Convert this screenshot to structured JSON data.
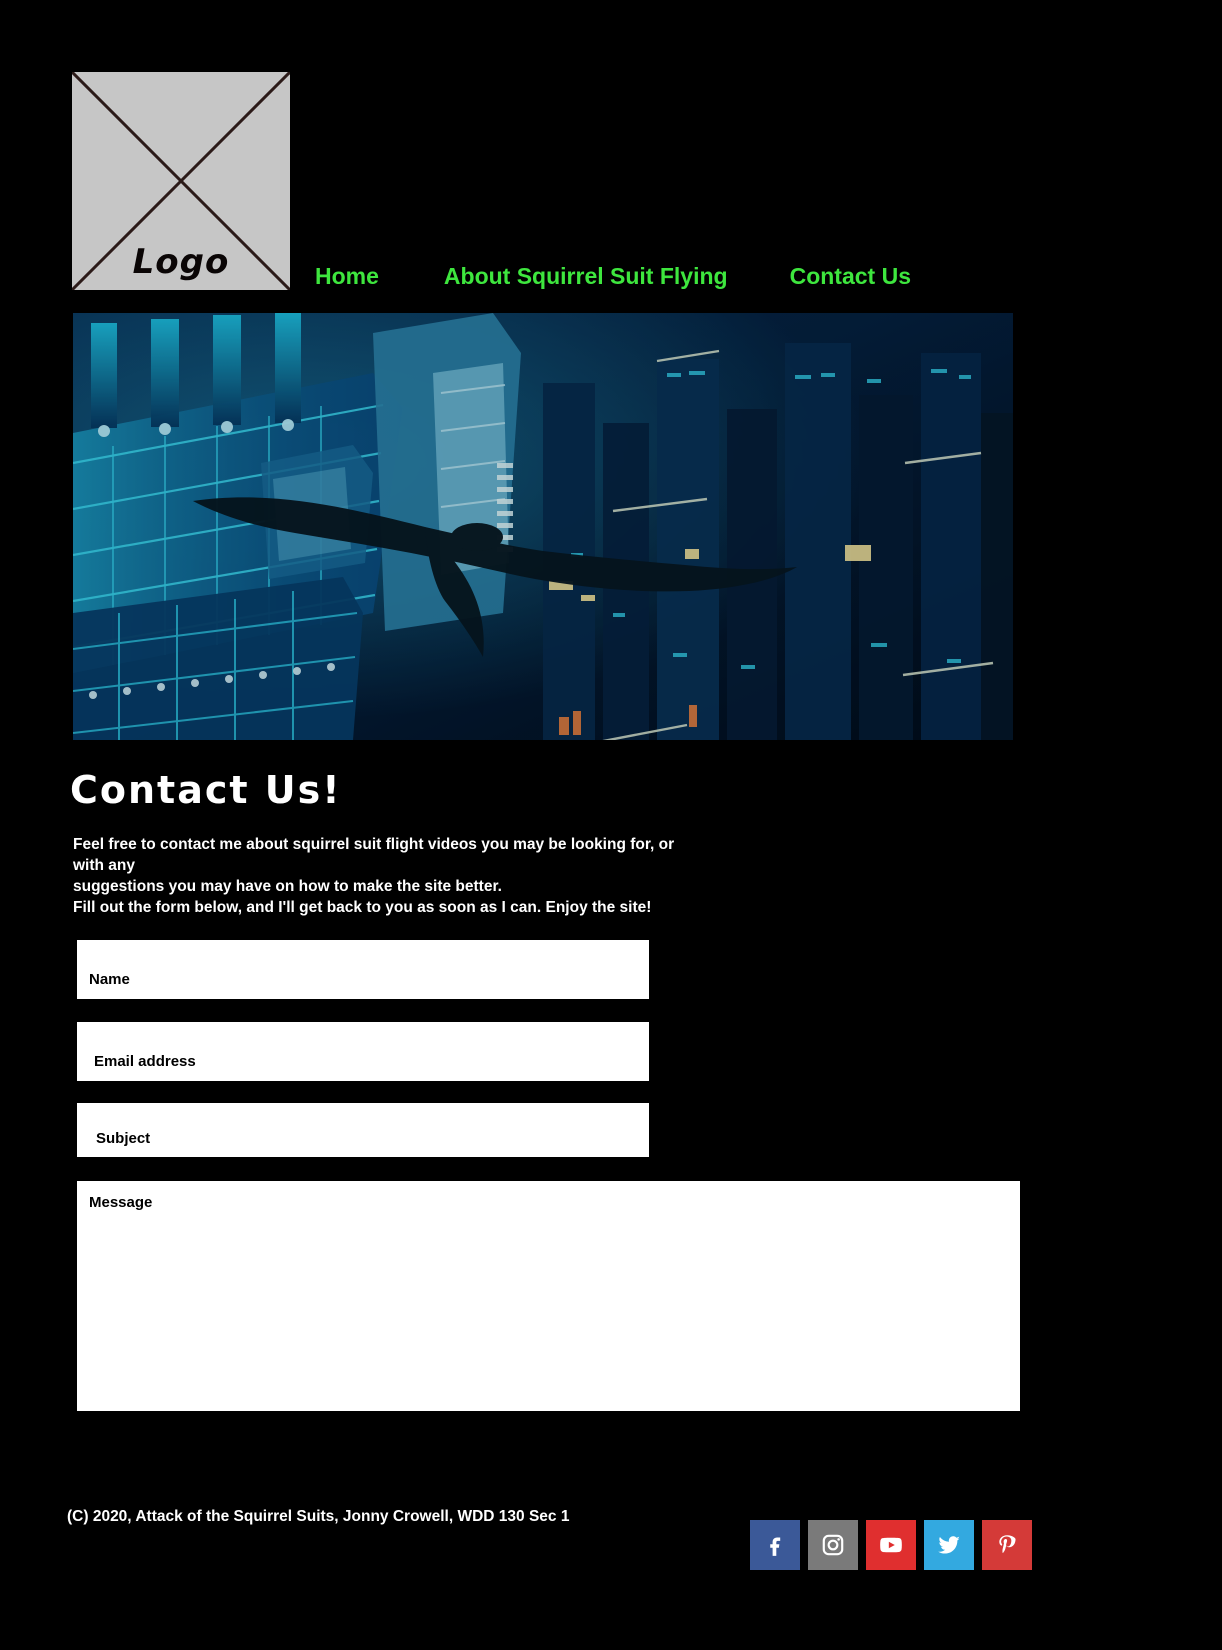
{
  "site": {
    "logo_alt": "Logo",
    "accent_green": "#3ee63e",
    "background": "#000000",
    "text_color": "#ffffff"
  },
  "nav": {
    "items": [
      {
        "label": "Home",
        "name": "nav-link-home"
      },
      {
        "label": "About Squirrel Suit Flying",
        "name": "nav-link-about"
      },
      {
        "label": "Contact Us",
        "name": "nav-link-contact"
      }
    ]
  },
  "hero": {
    "alt": "Night cityscape with illuminated blue skyscrapers and a gliding winged figure"
  },
  "main": {
    "title": "Contact Us!",
    "intro_lines": [
      "Feel free to contact me about squirrel suit flight videos you may be looking for, or with any",
      "suggestions you may have on how to make the site better.",
      "Fill out the form below, and I'll get back to you as soon as I can. Enjoy the site!"
    ]
  },
  "form": {
    "fields": [
      {
        "label": "Name",
        "value": "",
        "name": "name-input"
      },
      {
        "label": "Email address",
        "value": "",
        "name": "email-input"
      },
      {
        "label": "Subject",
        "value": "",
        "name": "subject-input"
      },
      {
        "label": "Message",
        "value": "",
        "name": "message-textarea"
      }
    ]
  },
  "footer": {
    "copyright": "(C) 2020, Attack of the Squirrel Suits, Jonny Crowell, WDD 130 Sec 1",
    "socials": [
      {
        "name": "facebook-icon",
        "label": "Facebook",
        "color": "#3b5998"
      },
      {
        "name": "instagram-icon",
        "label": "Instagram",
        "color": "#7a7a7a"
      },
      {
        "name": "youtube-icon",
        "label": "YouTube",
        "color": "#e02f2f"
      },
      {
        "name": "twitter-icon",
        "label": "Twitter",
        "color": "#33a9e0"
      },
      {
        "name": "pinterest-icon",
        "label": "Pinterest",
        "color": "#d43a38"
      }
    ]
  }
}
